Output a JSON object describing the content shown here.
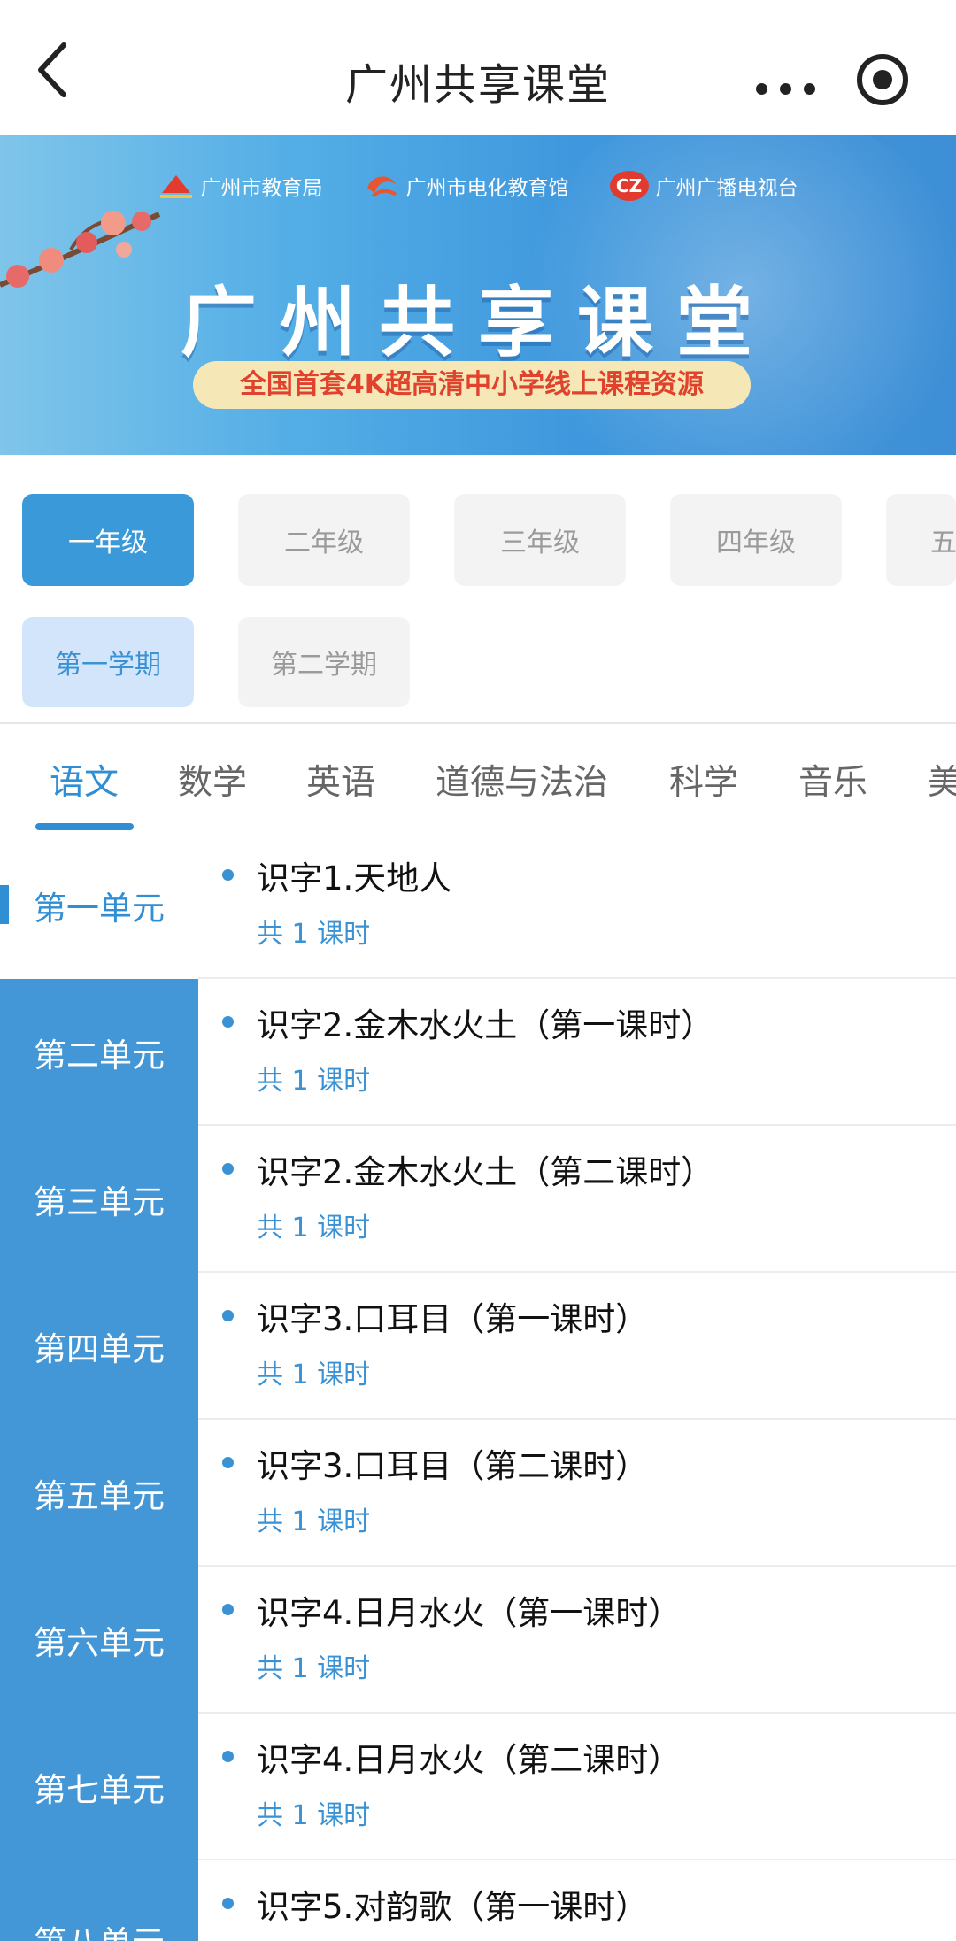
{
  "navbar": {
    "title": "广州共享课堂"
  },
  "banner": {
    "logos": [
      "广州市教育局",
      "广州市电化教育馆",
      "广州广播电视台"
    ],
    "cz_mark": "CZ",
    "title": "广州共享课堂",
    "subtitle": "全国首套4K超高清中小学线上课程资源"
  },
  "grades": [
    "一年级",
    "二年级",
    "三年级",
    "四年级",
    "五"
  ],
  "terms": [
    "第一学期",
    "第二学期"
  ],
  "subjects": [
    "语文",
    "数学",
    "英语",
    "道德与法治",
    "科学",
    "音乐",
    "美"
  ],
  "units": [
    "第一单元",
    "第二单元",
    "第三单元",
    "第四单元",
    "第五单元",
    "第六单元",
    "第七单元",
    "第八单元"
  ],
  "lessons": [
    {
      "title": "识字1.天地人",
      "count": "共 1 课时"
    },
    {
      "title": "识字2.金木水火土（第一课时）",
      "count": "共 1 课时"
    },
    {
      "title": "识字2.金木水火土（第二课时）",
      "count": "共 1 课时"
    },
    {
      "title": "识字3.口耳目（第一课时）",
      "count": "共 1 课时"
    },
    {
      "title": "识字3.口耳目（第二课时）",
      "count": "共 1 课时"
    },
    {
      "title": "识字4.日月水火（第一课时）",
      "count": "共 1 课时"
    },
    {
      "title": "识字4.日月水火（第二课时）",
      "count": "共 1 课时"
    },
    {
      "title": "识字5.对韵歌（第一课时）",
      "count": ""
    }
  ],
  "colors": {
    "accent": "#3a9ad9",
    "sidebar": "#4497d7",
    "term_active_bg": "#d3e5fb"
  },
  "icons": {
    "back": "chevron-left-icon",
    "more": "more-dots-icon",
    "target": "record-target-icon"
  }
}
